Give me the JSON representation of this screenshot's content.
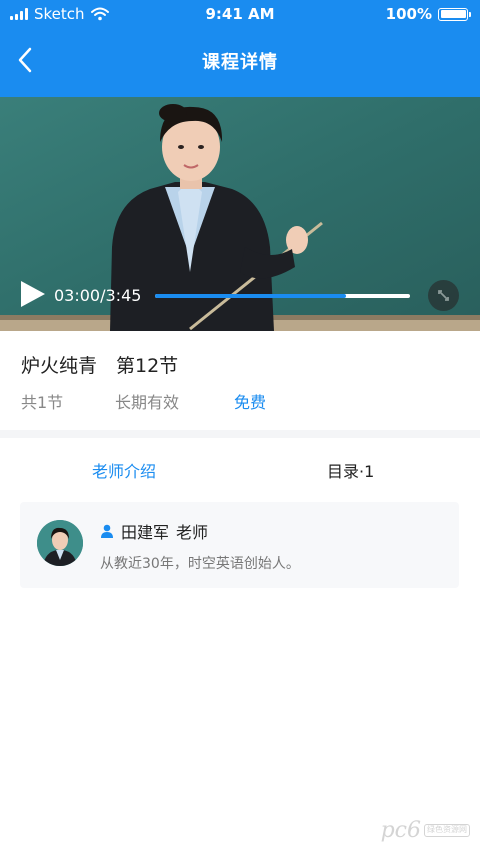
{
  "status_bar": {
    "carrier": "Sketch",
    "time": "9:41 AM",
    "battery": "100%"
  },
  "nav": {
    "title": "课程详情",
    "back_icon": "chevron-left-icon"
  },
  "video": {
    "time": "03:00/3:45",
    "progress": 0.75,
    "play_icon": "play-icon",
    "fullscreen_icon": "fullscreen-icon"
  },
  "course": {
    "title": "炉火纯青　第12节",
    "lessons": "共1节",
    "validity": "长期有效",
    "price": "免费"
  },
  "tabs": [
    {
      "label": "老师介绍",
      "active": true
    },
    {
      "label": "目录·1",
      "active": false
    }
  ],
  "teacher": {
    "name": "田建军",
    "role": "老师",
    "description": "从教近30年，时空英语创始人。"
  },
  "watermark": {
    "text": "pc6",
    "sub": "绿色资源网"
  },
  "colors": {
    "accent": "#1a8cf0",
    "chalkboard": "#2f6e6a"
  }
}
